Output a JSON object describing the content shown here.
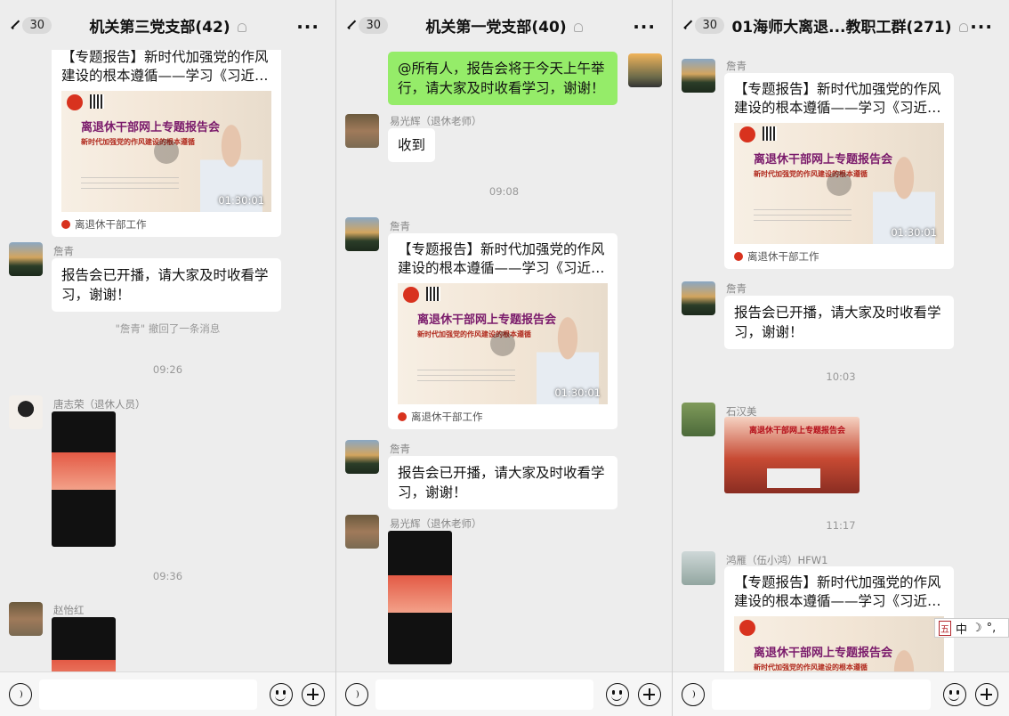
{
  "panels": [
    {
      "title": "机关第三党支部(42)",
      "unread": "30",
      "messages": {
        "card_title": "【专题报告】新时代加强党的作风建设的根本遵循——学习《习近…",
        "card_h1": "离退休干部网上专题报告会",
        "card_h2": "新时代加强党的作风建设的根本遵循",
        "card_duration": "01:30:01",
        "card_source": "离退休干部工作",
        "sender1": "詹青",
        "text1": "报告会已开播，请大家及时收看学习，谢谢！",
        "recall": "\"詹青\" 撤回了一条消息",
        "time1": "09:26",
        "sender2": "唐志荣（退休人员）",
        "time2": "09:36",
        "sender3": "赵怡红"
      }
    },
    {
      "title": "机关第一党支部(40)",
      "unread": "30",
      "messages": {
        "self_text": "@所有人，报告会将于今天上午举行，请大家及时收看学习，谢谢！",
        "sender1": "易光辉（退休老师）",
        "text1": "收到",
        "time1": "09:08",
        "sender2": "詹青",
        "card_title": "【专题报告】新时代加强党的作风建设的根本遵循——学习《习近…",
        "card_h1": "离退休干部网上专题报告会",
        "card_h2": "新时代加强党的作风建设的根本遵循",
        "card_duration": "01:30:01",
        "card_source": "离退休干部工作",
        "sender3": "詹青",
        "text3": "报告会已开播，请大家及时收看学习，谢谢！",
        "sender4": "易光辉（退休老师）"
      }
    },
    {
      "title": "01海师大离退...教职工群(271)",
      "unread": "30",
      "messages": {
        "sender1": "詹青",
        "card_title": "【专题报告】新时代加强党的作风建设的根本遵循——学习《习近…",
        "card_h1": "离退休干部网上专题报告会",
        "card_h2": "新时代加强党的作风建设的根本遵循",
        "card_duration": "01:30:01",
        "card_source": "离退休干部工作",
        "sender2": "詹青",
        "text2": "报告会已开播，请大家及时收看学习，谢谢！",
        "time1": "10:03",
        "sender3": "石汉美",
        "img_title": "离退休干部网上专题报告会",
        "time2": "11:17",
        "sender4": "鸿雁（伍小鸿）HFW1",
        "card2_title": "【专题报告】新时代加强党的作风建设的根本遵循——学习《习近…"
      }
    }
  ],
  "ime": {
    "wu": "五",
    "zh": "中",
    "moon": "☽",
    "punct": "°,"
  }
}
